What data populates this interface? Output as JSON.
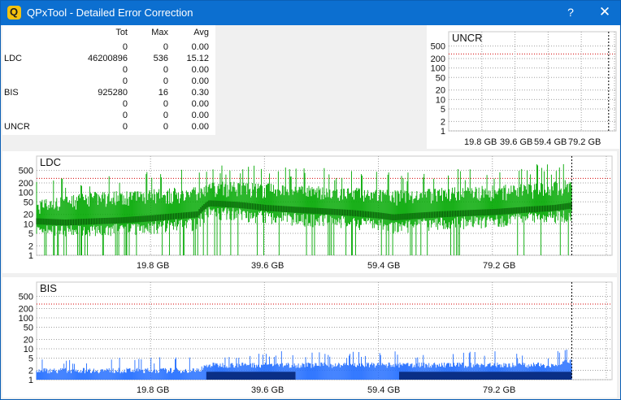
{
  "window": {
    "title": "QPxTool - Detailed Error Correction",
    "help_glyph": "?",
    "close_glyph": "✕",
    "app_icon_letter": "Q"
  },
  "stats": {
    "headers": {
      "label": "",
      "tot": "Tot",
      "max": "Max",
      "avg": "Avg"
    },
    "rows": [
      {
        "label": "",
        "tot": "0",
        "max": "0",
        "avg": "0.00"
      },
      {
        "label": "LDC",
        "tot": "46200896",
        "max": "536",
        "avg": "15.12"
      },
      {
        "label": "",
        "tot": "0",
        "max": "0",
        "avg": "0.00"
      },
      {
        "label": "",
        "tot": "0",
        "max": "0",
        "avg": "0.00"
      },
      {
        "label": "BIS",
        "tot": "925280",
        "max": "16",
        "avg": "0.30"
      },
      {
        "label": "",
        "tot": "0",
        "max": "0",
        "avg": "0.00"
      },
      {
        "label": "",
        "tot": "0",
        "max": "0",
        "avg": "0.00"
      },
      {
        "label": "UNCR",
        "tot": "0",
        "max": "0",
        "avg": "0.00"
      }
    ]
  },
  "chart_data": [
    {
      "type": "bar",
      "title": "UNCR",
      "y_scale": "log",
      "y_ticks": [
        "500",
        "200",
        "100",
        "50",
        "20",
        "10",
        "5",
        "2",
        "1"
      ],
      "x_ticks": [
        "19.8 GB",
        "39.6 GB",
        "59.4 GB",
        "79.2 GB"
      ],
      "x_range_gb": [
        0,
        100
      ],
      "values": [],
      "grid": true,
      "colors": {
        "series": "#000000"
      }
    },
    {
      "type": "bar",
      "title": "LDC",
      "y_scale": "log",
      "y_ticks": [
        "500",
        "200",
        "100",
        "50",
        "20",
        "10",
        "5",
        "2",
        "1"
      ],
      "x_ticks": [
        "19.8 GB",
        "39.6 GB",
        "59.4 GB",
        "79.2 GB"
      ],
      "x_range_gb": [
        0,
        100
      ],
      "series": [
        {
          "x_gb": [
            0,
            5,
            10,
            15,
            20,
            25,
            28,
            30,
            35,
            40,
            45,
            50,
            55,
            60,
            62,
            70,
            75,
            80,
            85,
            90,
            93
          ],
          "values": [
            12,
            11,
            12,
            13,
            15,
            18,
            20,
            45,
            40,
            32,
            28,
            25,
            22,
            18,
            16,
            20,
            22,
            24,
            28,
            32,
            38
          ]
        },
        {
          "x_gb": [
            0,
            5,
            10,
            15,
            20,
            25,
            28,
            30,
            35,
            40,
            45,
            50,
            55,
            60,
            62,
            70,
            75,
            80,
            85,
            90,
            93
          ],
          "values": [
            45,
            60,
            80,
            90,
            100,
            110,
            120,
            180,
            170,
            150,
            130,
            120,
            110,
            100,
            90,
            110,
            120,
            130,
            150,
            170,
            200
          ]
        }
      ],
      "grid": true,
      "colors": {
        "max": "#00a800",
        "avg": "#0a5d0a"
      }
    },
    {
      "type": "bar",
      "title": "BIS",
      "y_scale": "log",
      "y_ticks": [
        "500",
        "200",
        "100",
        "50",
        "20",
        "10",
        "5",
        "2",
        "1"
      ],
      "x_ticks": [
        "19.8 GB",
        "39.6 GB",
        "59.4 GB",
        "79.2 GB"
      ],
      "x_range_gb": [
        0,
        100
      ],
      "series": [
        {
          "x_gb": [
            0,
            10,
            20,
            28,
            30,
            40,
            50,
            60,
            62,
            70,
            80,
            90,
            93
          ],
          "values": [
            2,
            2,
            2,
            2,
            3,
            3,
            3,
            3,
            3,
            3,
            3,
            3,
            4
          ]
        }
      ],
      "grid": true,
      "colors": {
        "series": "#1f6bff",
        "dark": "#0a2f86"
      }
    }
  ]
}
